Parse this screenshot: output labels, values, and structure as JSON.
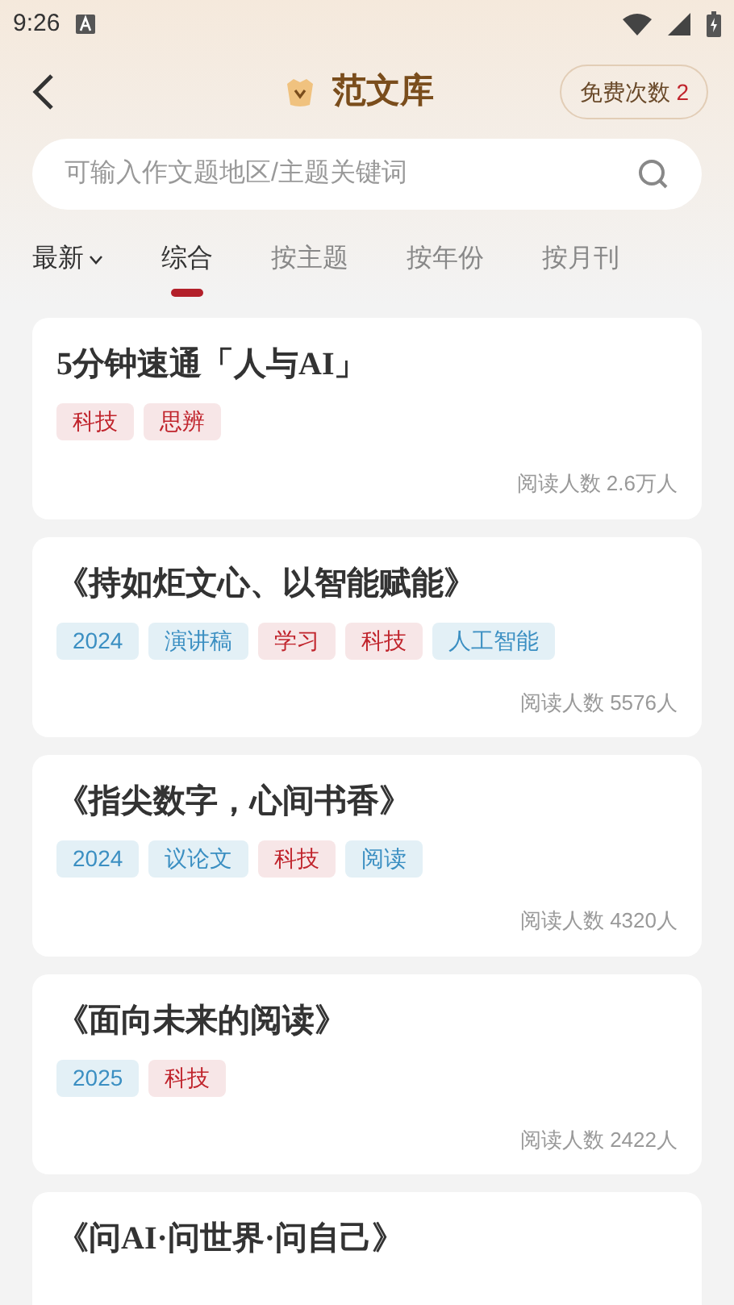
{
  "status_bar": {
    "time": "9:26"
  },
  "header": {
    "title": "范文库",
    "free_label": "免费次数",
    "free_count": "2"
  },
  "search": {
    "placeholder": "可输入作文题地区/主题关键词"
  },
  "sort": {
    "label": "最新"
  },
  "tabs": [
    {
      "label": "综合",
      "selected": true
    },
    {
      "label": "按主题",
      "selected": false
    },
    {
      "label": "按年份",
      "selected": false
    },
    {
      "label": "按月刊",
      "selected": false
    }
  ],
  "articles": [
    {
      "title": "5分钟速通「人与AI」",
      "tags": [
        {
          "label": "科技",
          "color": "#c0242c"
        },
        {
          "label": "思辨",
          "color": "#c0242c"
        }
      ],
      "readers": "阅读人数 2.6万人"
    },
    {
      "title": "《持如炬文心、以智能赋能》",
      "tags": [
        {
          "label": "2024",
          "color": "#3b8fc2"
        },
        {
          "label": "演讲稿",
          "color": "#3b8fc2"
        },
        {
          "label": "学习",
          "color": "#c0242c"
        },
        {
          "label": "科技",
          "color": "#c0242c"
        },
        {
          "label": "人工智能",
          "color": "#3b8fc2"
        }
      ],
      "readers": "阅读人数 5576人"
    },
    {
      "title": "《指尖数字，心间书香》",
      "tags": [
        {
          "label": "2024",
          "color": "#3b8fc2"
        },
        {
          "label": "议论文",
          "color": "#3b8fc2"
        },
        {
          "label": "科技",
          "color": "#c0242c"
        },
        {
          "label": "阅读",
          "color": "#3b8fc2"
        }
      ],
      "readers": "阅读人数 4320人"
    },
    {
      "title": "《面向未来的阅读》",
      "tags": [
        {
          "label": "2025",
          "color": "#3b8fc2"
        },
        {
          "label": "科技",
          "color": "#c0242c"
        }
      ],
      "readers": "阅读人数 2422人"
    },
    {
      "title": "《问AI·问世界·问自己》"
    }
  ]
}
